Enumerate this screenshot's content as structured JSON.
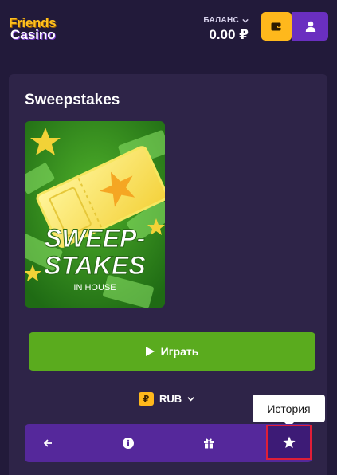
{
  "brand": {
    "line1": "Friends",
    "line2": "Casino"
  },
  "balance": {
    "label": "БАЛАНС",
    "amount": "0.00 ₽"
  },
  "header_icons": {
    "wallet": "wallet-icon",
    "user": "user-icon"
  },
  "game": {
    "title": "Sweepstakes",
    "thumbnail": {
      "line1": "SWEEP-",
      "line2": "STAKES",
      "subtitle": "IN HOUSE"
    }
  },
  "play_button": {
    "label": "Играть"
  },
  "currency": {
    "badge": "₽",
    "code": "RUB"
  },
  "toolbar": {
    "items": [
      "back-arrow-icon",
      "info-icon",
      "gift-icon",
      "star-icon"
    ],
    "tooltip": "История"
  },
  "colors": {
    "background": "#221a3a",
    "card": "#2e2448",
    "accent_yellow": "#ffb81c",
    "accent_purple": "#6a2fc0",
    "play_green": "#5aab1e",
    "highlight_red": "#e01e37"
  }
}
